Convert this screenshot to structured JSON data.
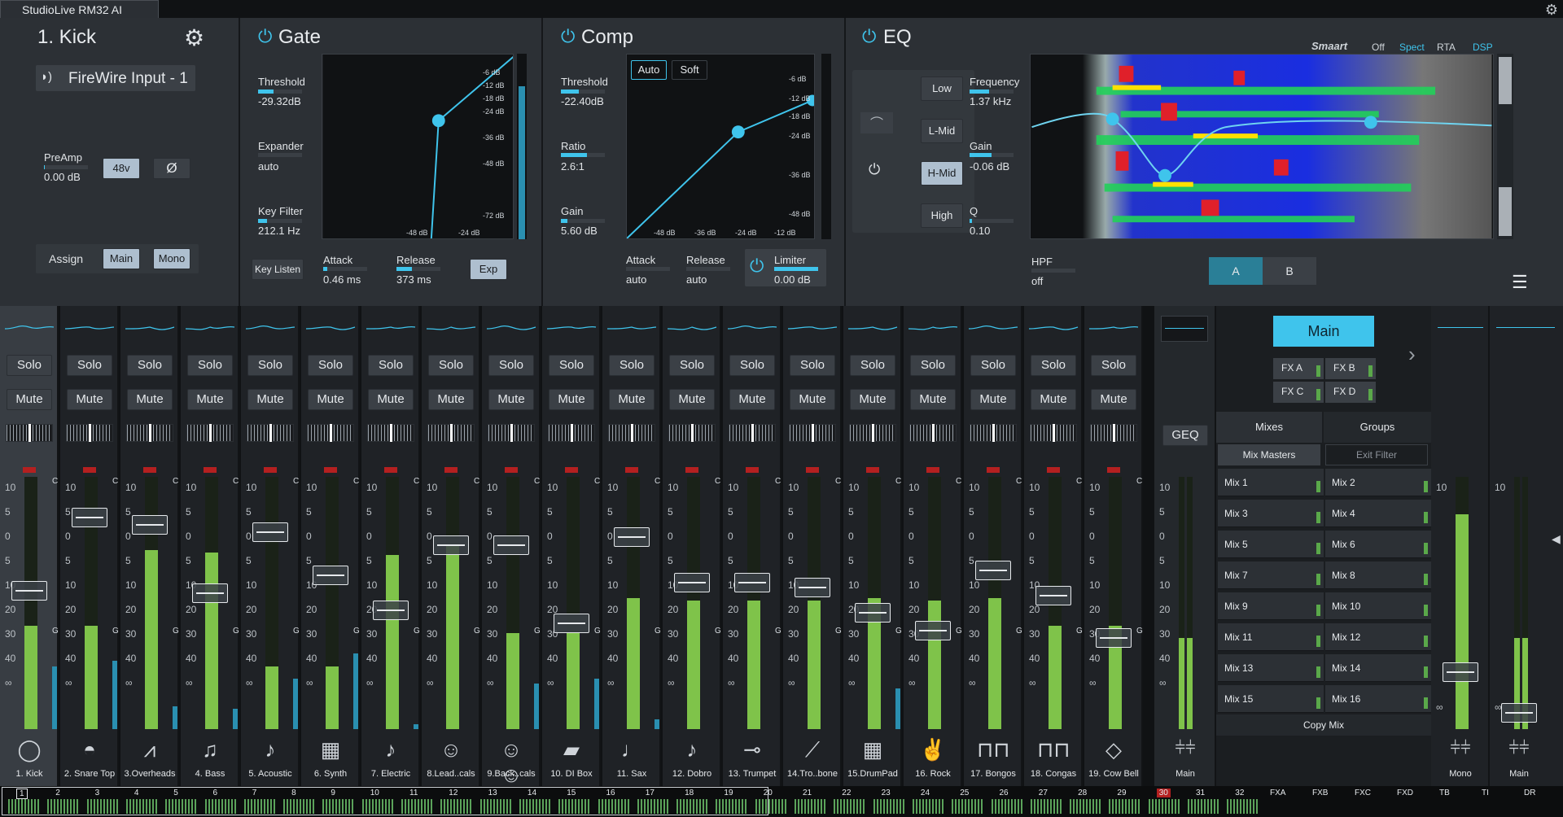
{
  "window": {
    "title": "StudioLive RM32 AI"
  },
  "channel_panel": {
    "name": "1. Kick",
    "input": "FireWire Input - 1",
    "preamp_label": "PreAmp",
    "preamp_value": "0.00 dB",
    "phantom": "48v",
    "phase": "Ø",
    "assign_label": "Assign",
    "assign_main": "Main",
    "assign_mono": "Mono",
    "preamp_level": 0.0
  },
  "gate": {
    "title": "Gate",
    "threshold_label": "Threshold",
    "threshold": "-29.32dB",
    "threshold_level": 0.35,
    "expander_label": "Expander",
    "expander": "auto",
    "keyfilter_label": "Key Filter",
    "keyfilter": "212.1 Hz",
    "keyfilter_level": 0.2,
    "key_listen": "Key Listen",
    "attack_label": "Attack",
    "attack": "0.46 ms",
    "attack_level": 0.1,
    "release_label": "Release",
    "release": "373 ms",
    "release_level": 0.35,
    "exp": "Exp",
    "graph_right_labels": [
      "-6 dB",
      "-12 dB",
      "-18 dB",
      "-24 dB",
      "-36 dB",
      "-48 dB",
      "-72 dB"
    ],
    "graph_bottom_labels": [
      "-48 dB",
      "-24 dB"
    ]
  },
  "comp": {
    "title": "Comp",
    "auto": "Auto",
    "soft": "Soft",
    "threshold_label": "Threshold",
    "threshold": "-22.40dB",
    "threshold_level": 0.4,
    "ratio_label": "Ratio",
    "ratio": "2.6:1",
    "ratio_level": 0.3,
    "gain_label": "Gain",
    "gain": "5.60 dB",
    "gain_level": 0.15,
    "attack_label": "Attack",
    "attack": "auto",
    "release_label": "Release",
    "release": "auto",
    "limiter_label": "Limiter",
    "limiter": "0.00 dB",
    "limiter_level": 1.0,
    "graph_right_labels": [
      "-6 dB",
      "-12 dB",
      "-18 dB",
      "-24 dB",
      "-36 dB",
      "-48 dB"
    ],
    "graph_bottom_labels": [
      "-48 dB",
      "-36 dB",
      "-24 dB",
      "-12 dB"
    ]
  },
  "eq": {
    "title": "EQ",
    "bands": [
      "Low",
      "L-Mid",
      "H-Mid",
      "High"
    ],
    "selected_band": "H-Mid",
    "frequency_label": "Frequency",
    "frequency": "1.37 kHz",
    "frequency_level": 0.45,
    "gain_label": "Gain",
    "gain": "-0.06 dB",
    "gain_level": 0.5,
    "q_label": "Q",
    "q": "0.10",
    "q_level": 0.05,
    "hpf_label": "HPF",
    "hpf": "off",
    "hpf_level": 0.0,
    "smaart": "Smaart",
    "modes": [
      "Off",
      "Spect",
      "RTA",
      "DSP"
    ],
    "ab": [
      "A",
      "B"
    ]
  },
  "channels": [
    {
      "name": "1. Kick",
      "fader": 0.55,
      "meter": 0.41,
      "meter2": 0.25,
      "icon": "kick-drum-icon",
      "glyph": "◯"
    },
    {
      "name": "2. Snare Top",
      "fader": 0.84,
      "meter": 0.41,
      "meter2": 0.27,
      "icon": "snare-drum-icon",
      "glyph": "◓"
    },
    {
      "name": "3.Overheads",
      "fader": 0.81,
      "meter": 0.71,
      "meter2": 0.09,
      "icon": "overheads-icon",
      "glyph": "⩘"
    },
    {
      "name": "4. Bass",
      "fader": 0.54,
      "meter": 0.7,
      "meter2": 0.08,
      "icon": "bass-guitar-icon",
      "glyph": "♫"
    },
    {
      "name": "5. Acoustic",
      "fader": 0.78,
      "meter": 0.25,
      "meter2": 0.2,
      "icon": "acoustic-guitar-icon",
      "glyph": "♪"
    },
    {
      "name": "6. Synth",
      "fader": 0.61,
      "meter": 0.25,
      "meter2": 0.3,
      "icon": "synth-icon",
      "glyph": "▦"
    },
    {
      "name": "7. Electric",
      "fader": 0.47,
      "meter": 0.69,
      "meter2": 0.02,
      "icon": "electric-guitar-icon",
      "glyph": "♪"
    },
    {
      "name": "8.Lead..cals",
      "fader": 0.73,
      "meter": 0.73,
      "meter2": 0.0,
      "icon": "lead-vocals-icon",
      "glyph": "☺"
    },
    {
      "name": "9.Back..cals",
      "fader": 0.73,
      "meter": 0.38,
      "meter2": 0.18,
      "icon": "backing-vocals-icon",
      "glyph": "☺☺"
    },
    {
      "name": "10. DI Box",
      "fader": 0.42,
      "meter": 0.38,
      "meter2": 0.2,
      "icon": "di-box-icon",
      "glyph": "▰"
    },
    {
      "name": "11. Sax",
      "fader": 0.76,
      "meter": 0.52,
      "meter2": 0.04,
      "icon": "sax-icon",
      "glyph": "♩"
    },
    {
      "name": "12. Dobro",
      "fader": 0.58,
      "meter": 0.51,
      "meter2": 0.0,
      "icon": "dobro-icon",
      "glyph": "♪"
    },
    {
      "name": "13. Trumpet",
      "fader": 0.58,
      "meter": 0.51,
      "meter2": 0.0,
      "icon": "trumpet-icon",
      "glyph": "⊸"
    },
    {
      "name": "14.Tro..bone",
      "fader": 0.56,
      "meter": 0.51,
      "meter2": 0.0,
      "icon": "trombone-icon",
      "glyph": "⟋"
    },
    {
      "name": "15.DrumPad",
      "fader": 0.46,
      "meter": 0.52,
      "meter2": 0.16,
      "icon": "drum-pad-icon",
      "glyph": "▦"
    },
    {
      "name": "16. Rock",
      "fader": 0.39,
      "meter": 0.51,
      "meter2": 0.0,
      "icon": "rock-hand-icon",
      "glyph": "✌"
    },
    {
      "name": "17. Bongos",
      "fader": 0.63,
      "meter": 0.52,
      "meter2": 0.0,
      "icon": "bongos-icon",
      "glyph": "⊓⊓"
    },
    {
      "name": "18. Congas",
      "fader": 0.53,
      "meter": 0.41,
      "meter2": 0.0,
      "icon": "congas-icon",
      "glyph": "⊓⊓"
    },
    {
      "name": "19. Cow Bell",
      "fader": 0.36,
      "meter": 0.41,
      "meter2": 0.0,
      "icon": "cowbell-icon",
      "glyph": "◇"
    }
  ],
  "strip_labels": {
    "solo": "Solo",
    "mute": "Mute",
    "clip": "C",
    "gain": "G",
    "scale": [
      "10",
      "5",
      "0",
      "5",
      "10",
      "20",
      "30",
      "40",
      "∞"
    ]
  },
  "main_strip": {
    "name": "Main",
    "geq": "GEQ",
    "meter": 0.36
  },
  "mixes_panel": {
    "main": "Main",
    "fx": [
      "FX A",
      "FX B",
      "FX C",
      "FX D"
    ],
    "tabs": [
      "Mixes",
      "Groups"
    ],
    "mix_masters": "Mix Masters",
    "exit_filter": "Exit Filter",
    "copy_mix": "Copy Mix",
    "mixes": [
      "Mix 1",
      "Mix 2",
      "Mix 3",
      "Mix 4",
      "Mix 5",
      "Mix 6",
      "Mix 7",
      "Mix 8",
      "Mix 9",
      "Mix 10",
      "Mix 11",
      "Mix 12",
      "Mix 13",
      "Mix 14",
      "Mix 15",
      "Mix 16"
    ]
  },
  "mono_strip": {
    "name": "Mono",
    "fader": 0.33,
    "meter": 0.85
  },
  "main_out": {
    "name": "Main",
    "fader": 0.06,
    "meter": 0.36
  },
  "navigator": {
    "numbers": [
      "1",
      "2",
      "3",
      "4",
      "5",
      "6",
      "7",
      "8",
      "9",
      "10",
      "11",
      "12",
      "13",
      "14",
      "15",
      "16",
      "17",
      "18",
      "19",
      "20",
      "21",
      "22",
      "23",
      "24",
      "25",
      "26",
      "27",
      "28",
      "29",
      "30",
      "31",
      "32",
      "FXA",
      "FXB",
      "FXC",
      "FXD",
      "TB",
      "TI",
      "DR"
    ],
    "selected": "1",
    "alert": "30"
  }
}
